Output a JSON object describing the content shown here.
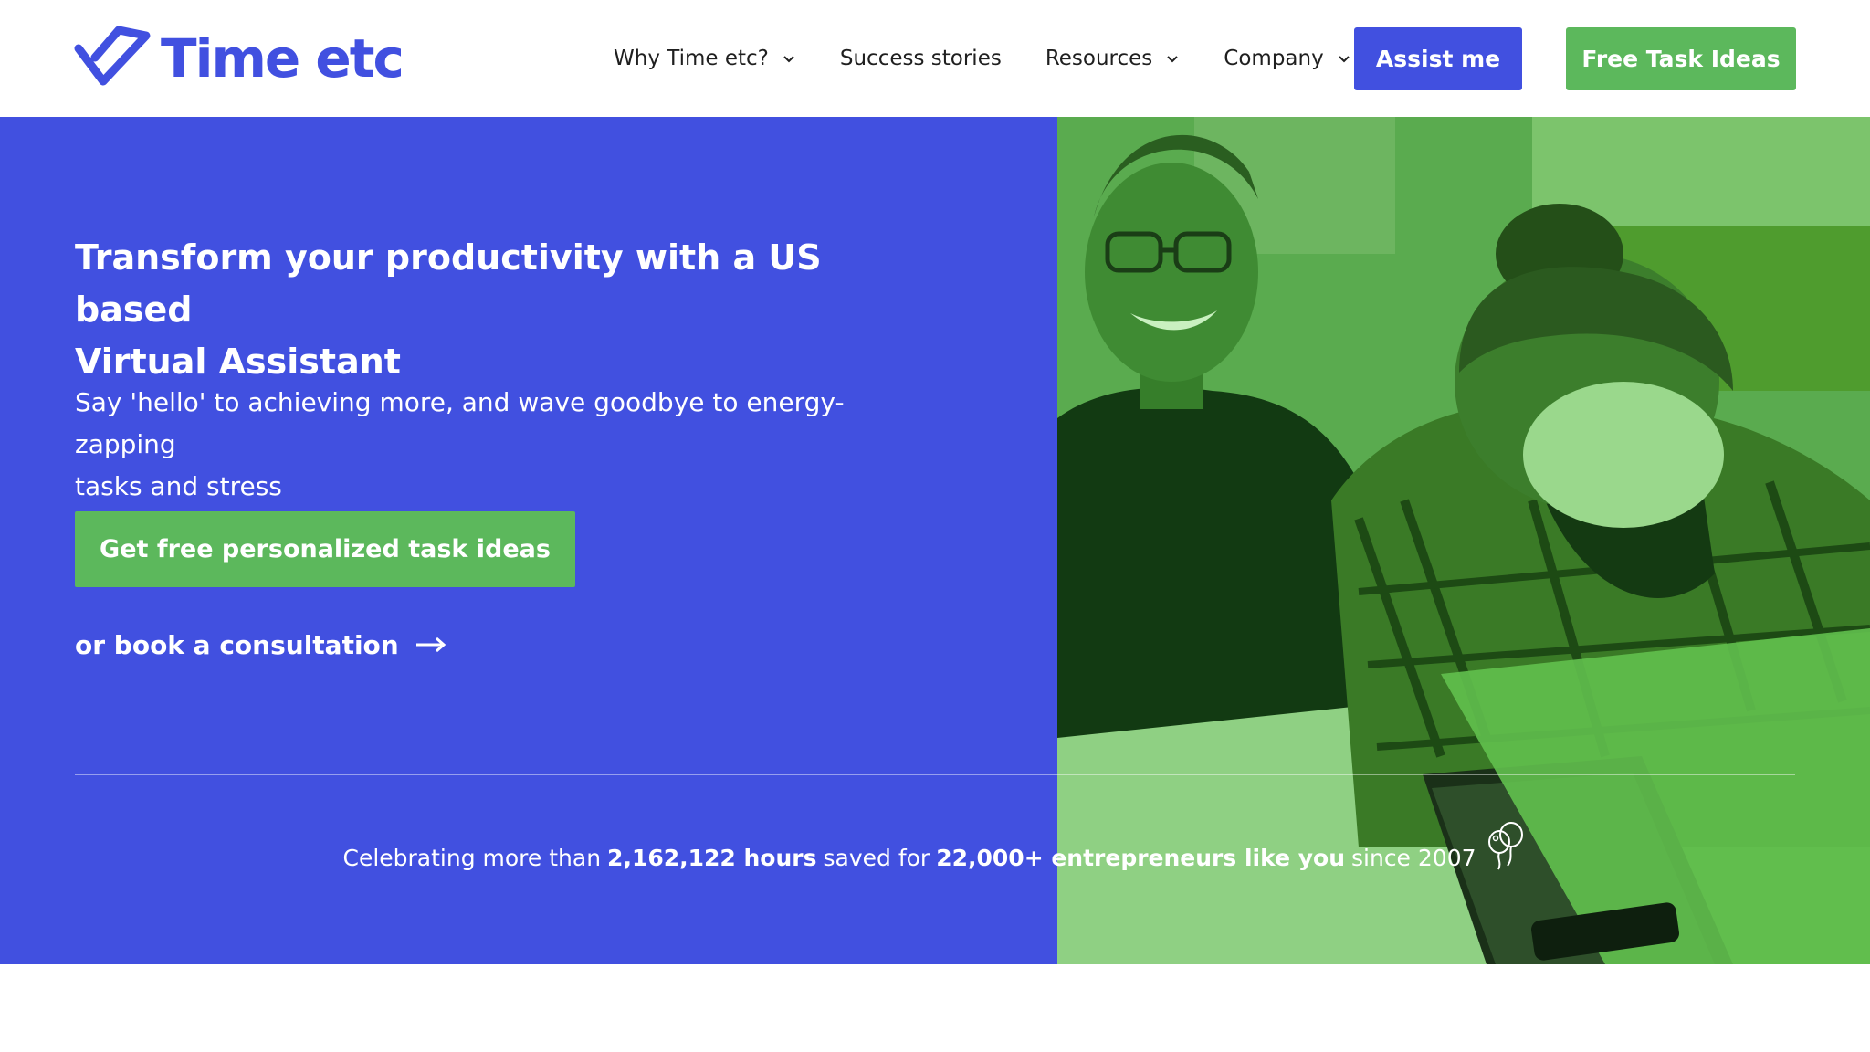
{
  "header": {
    "logo_text": "Time etc",
    "nav": [
      {
        "label": "Why Time etc?",
        "has_dropdown": true
      },
      {
        "label": "Success stories",
        "has_dropdown": false
      },
      {
        "label": "Resources",
        "has_dropdown": true
      },
      {
        "label": "Company",
        "has_dropdown": true
      }
    ],
    "assist_label": "Assist me",
    "ideas_label": "Free Task Ideas"
  },
  "hero": {
    "title_line1": "Transform your productivity with a US based",
    "title_line2": "Virtual Assistant",
    "subtitle_line1": "Say 'hello' to achieving more, and wave goodbye to energy-zapping",
    "subtitle_line2": "tasks and stress",
    "cta_label": "Get free personalized task ideas",
    "consult_label": "or book a consultation",
    "stats": {
      "prefix": "Celebrating more than",
      "hours": "2,162,122 hours",
      "middle": "saved for",
      "entrepreneurs": "22,000+ entrepreneurs like you",
      "suffix": "since 2007"
    }
  },
  "colors": {
    "brand_blue": "#4150e0",
    "brand_green": "#5cb85c",
    "text_dark": "#1f1f1f",
    "white": "#ffffff"
  },
  "icons": {
    "logo": "checkmark-logo-icon",
    "dropdown": "chevron-down-icon",
    "consult": "arrow-right-icon",
    "stats": "balloons-icon"
  }
}
